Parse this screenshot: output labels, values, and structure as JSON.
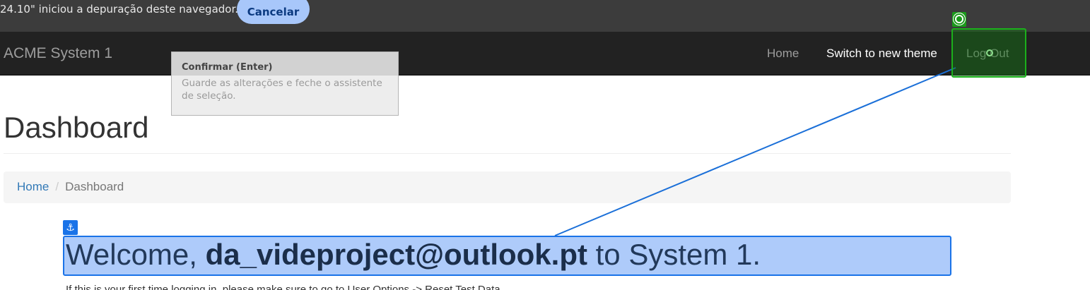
{
  "debug_banner": {
    "message": "24.10\" iniciou a depuração deste navegador.",
    "cancel_label": "Cancelar"
  },
  "navbar": {
    "brand": "ACME System 1",
    "items": [
      {
        "label": "Home"
      },
      {
        "label": "Switch to new theme"
      },
      {
        "label": "Log Out"
      }
    ]
  },
  "tooltip": {
    "title": "Confirmar (Enter)",
    "body": "Guarde as alterações e feche o assistente de seleção."
  },
  "page": {
    "title": "Dashboard",
    "breadcrumb": {
      "home": "Home",
      "separator": "/",
      "current": "Dashboard"
    },
    "welcome": {
      "prefix": "Welcome,",
      "user": "da_videproject@outlook.pt",
      "suffix": "to System 1."
    },
    "info": "If this is your first time logging in, please make sure to go to User Options -> Reset Test Data"
  },
  "overlay": {
    "anchor_icon": "anchor-icon",
    "target_icon": "target-icon",
    "line_color": "#1a6fd8",
    "target_color": "#1bb01b"
  }
}
